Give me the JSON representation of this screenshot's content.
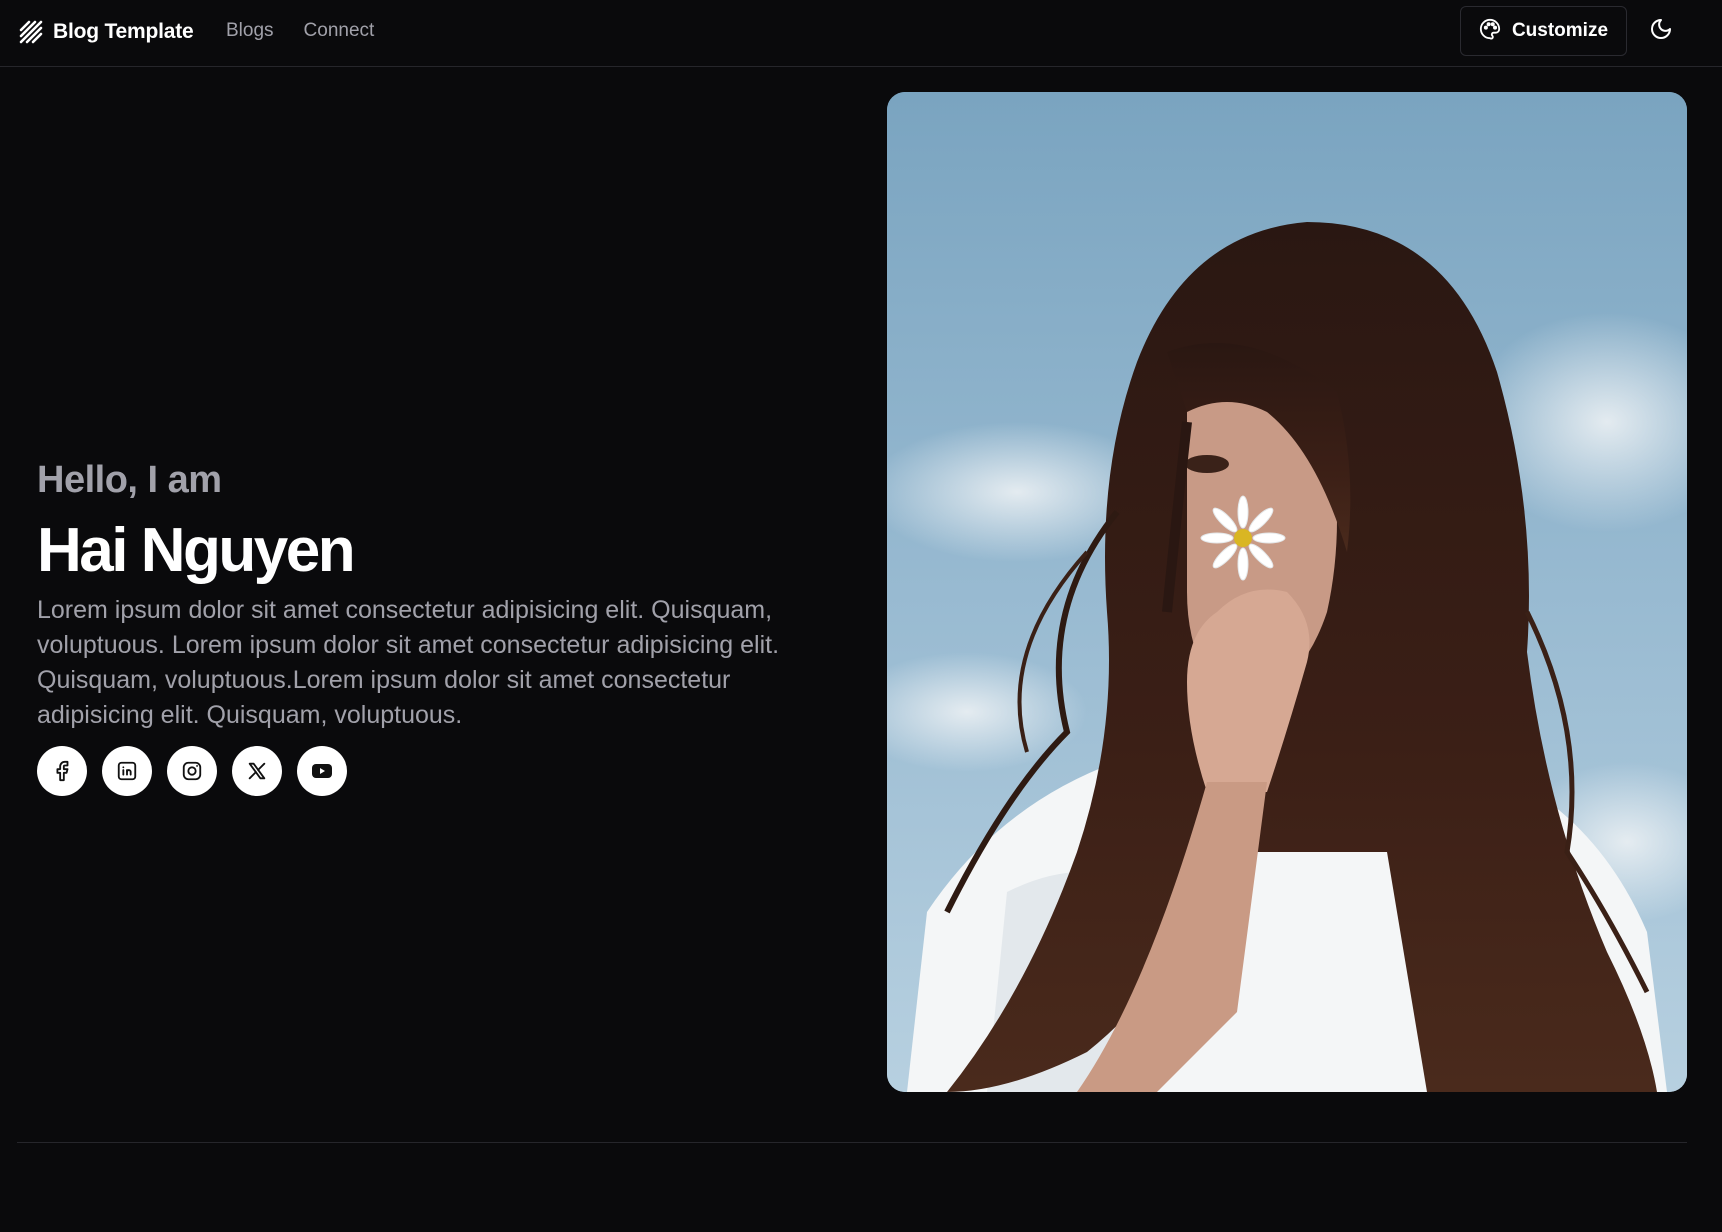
{
  "header": {
    "brand": "Blog Template",
    "brand_icon": "slashes-logo-icon",
    "nav": [
      {
        "label": "Blogs"
      },
      {
        "label": "Connect"
      }
    ],
    "customize_label": "Customize",
    "customize_icon": "palette-icon",
    "theme_icon": "moon-icon"
  },
  "hero": {
    "greeting": "Hello, I am",
    "name": "Hai Nguyen",
    "bio": "Lorem ipsum dolor sit amet consectetur adipisicing elit. Quisquam, voluptuous. Lorem ipsum dolor sit amet consectetur adipisicing elit. Quisquam, voluptuous.Lorem ipsum dolor sit amet consectetur adipisicing elit. Quisquam, voluptuous.",
    "socials": [
      {
        "icon": "facebook-icon"
      },
      {
        "icon": "linkedin-icon"
      },
      {
        "icon": "instagram-icon"
      },
      {
        "icon": "x-icon"
      },
      {
        "icon": "youtube-icon"
      }
    ]
  },
  "colors": {
    "background": "#0a0a0c",
    "text_primary": "#ffffff",
    "text_muted": "#a1a1aa",
    "border": "#26262b"
  }
}
